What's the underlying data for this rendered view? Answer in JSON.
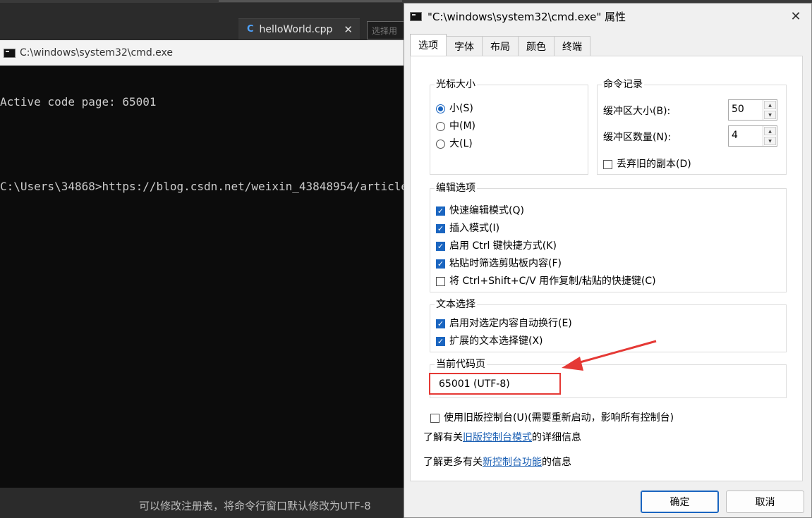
{
  "editor": {
    "tab_label": "helloWorld.cpp",
    "tab_icon": "C",
    "tab_close": "✕",
    "search_placeholder": "选择用",
    "bottom_text": "可以修改注册表，将命令行窗口默认修改为UTF-8"
  },
  "console": {
    "title": "C:\\windows\\system32\\cmd.exe",
    "lines": [
      "Active code page: 65001",
      "C:\\Users\\34868>https://blog.csdn.net/weixin_43848954/article"
    ]
  },
  "dialog": {
    "title": "\"C:\\windows\\system32\\cmd.exe\" 属性",
    "close_glyph": "✕",
    "tabs": [
      {
        "label": "选项"
      },
      {
        "label": "字体"
      },
      {
        "label": "布局"
      },
      {
        "label": "颜色"
      },
      {
        "label": "终端"
      }
    ],
    "cursor_size": {
      "title": "光标大小",
      "options": [
        {
          "label": "小(S)"
        },
        {
          "label": "中(M)"
        },
        {
          "label": "大(L)"
        }
      ]
    },
    "command_history": {
      "title": "命令记录",
      "buffer_size_label": "缓冲区大小(B):",
      "buffer_size_value": "50",
      "buffer_count_label": "缓冲区数量(N):",
      "buffer_count_value": "4",
      "discard_label": "丢弃旧的副本(D)"
    },
    "edit_options": {
      "title": "编辑选项",
      "items": [
        {
          "label": "快速编辑模式(Q)"
        },
        {
          "label": "插入模式(I)"
        },
        {
          "label": "启用 Ctrl 键快捷方式(K)"
        },
        {
          "label": "粘贴时筛选剪贴板内容(F)"
        },
        {
          "label": "将 Ctrl+Shift+C/V 用作复制/粘贴的快捷键(C)"
        }
      ]
    },
    "text_selection": {
      "title": "文本选择",
      "items": [
        {
          "label": "启用对选定内容自动换行(E)"
        },
        {
          "label": "扩展的文本选择键(X)"
        }
      ]
    },
    "code_page": {
      "title": "当前代码页",
      "value": "65001 (UTF-8)"
    },
    "legacy_console_label": "使用旧版控制台(U)(需要重新启动，影响所有控制台)",
    "legacy_info": {
      "prefix": "了解有关",
      "link": "旧版控制台模式",
      "suffix": "的详细信息"
    },
    "new_features_info": {
      "prefix": "了解更多有关",
      "link": "新控制台功能",
      "suffix": "的信息"
    },
    "ok_label": "确定",
    "cancel_label": "取消"
  },
  "colors": {
    "accent": "#1a65c0",
    "annotation_red": "#e53935",
    "link": "#1a5fb4"
  }
}
